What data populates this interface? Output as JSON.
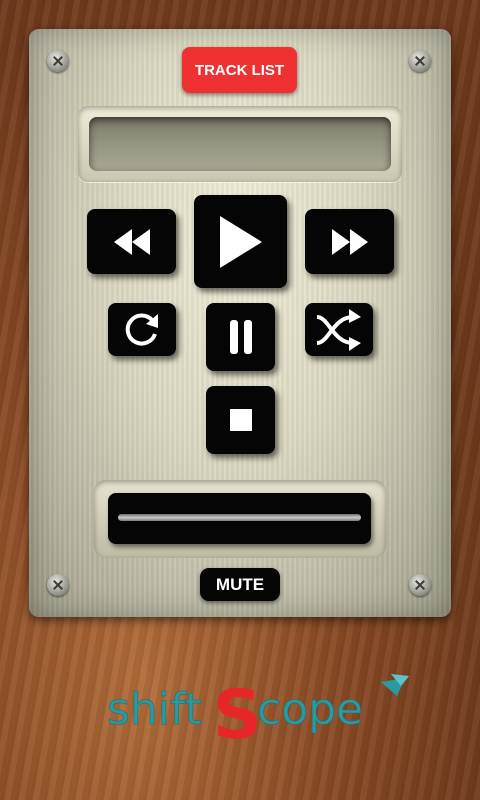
{
  "header": {
    "track_list_label": "TRACK LIST"
  },
  "display": {
    "text": ""
  },
  "controls": {
    "rewind_icon": "rewind-icon",
    "play_icon": "play-icon",
    "fast_forward_icon": "fast-forward-icon",
    "repeat_icon": "repeat-icon",
    "pause_icon": "pause-icon",
    "shuffle_icon": "shuffle-icon",
    "stop_icon": "stop-icon"
  },
  "progress": {
    "value": 0
  },
  "footer": {
    "mute_label": "MUTE"
  },
  "brand": {
    "logo_text": "shiftScope",
    "colors": {
      "teal": "#2a9aa0",
      "red": "#e8262a"
    }
  },
  "colors": {
    "accent_red": "#ef3131",
    "button_black": "#050505"
  }
}
